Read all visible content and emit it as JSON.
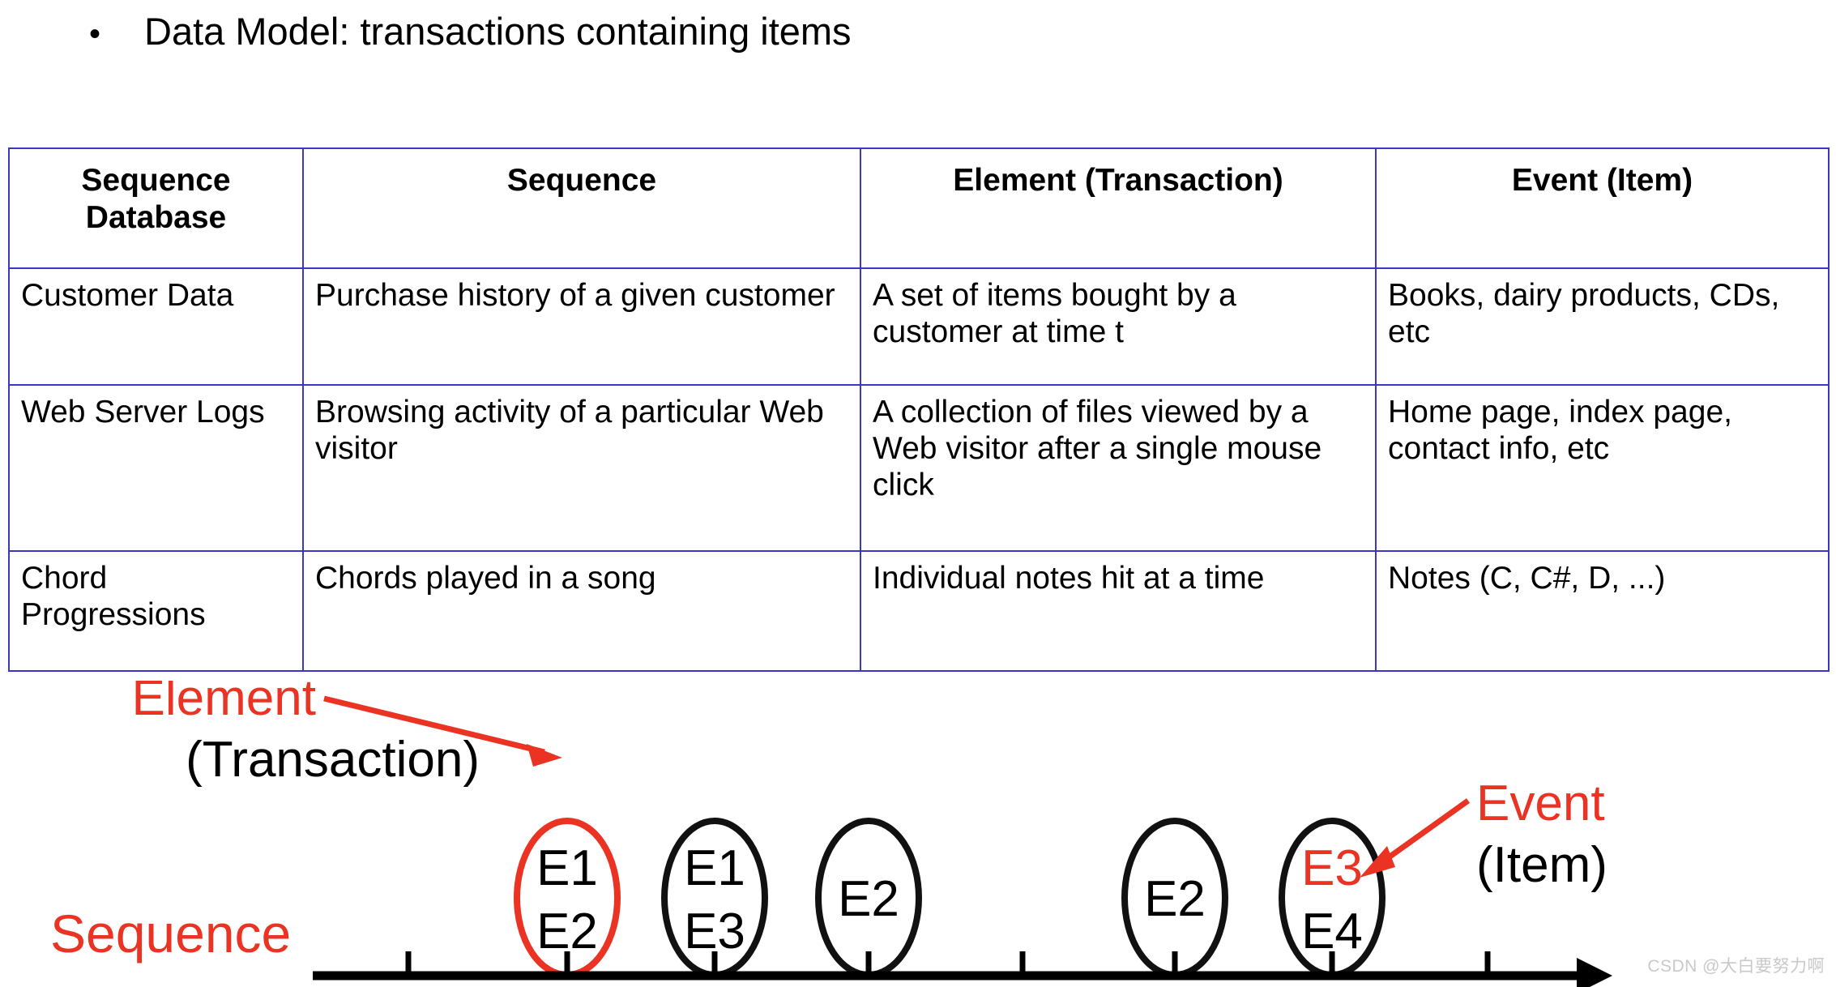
{
  "slide": {
    "bullet_glyph": "•",
    "title": "Data Model: transactions containing items"
  },
  "table": {
    "headers": [
      "Sequence Database",
      "Sequence",
      "Element (Transaction)",
      "Event (Item)"
    ],
    "rows": [
      {
        "database": "Customer Data",
        "sequence": "Purchase history of a given customer",
        "element": "A set of items bought by a customer at time t",
        "event": "Books, dairy products, CDs, etc"
      },
      {
        "database": "Web Server Logs",
        "sequence": "Browsing activity of a particular Web visitor",
        "element": "A collection of files viewed by a Web visitor after a single mouse click",
        "event": "Home page, index page, contact info, etc"
      },
      {
        "database": "Chord Progressions",
        "sequence": "Chords played in a song",
        "element": "Individual notes hit at a time",
        "event": "Notes (C, C#, D, ...)"
      }
    ],
    "border_color": "#3c36c4"
  },
  "diagram": {
    "labels": {
      "element_highlight": "Element",
      "element_sub": "(Transaction)",
      "event_highlight": "Event",
      "event_sub": "(Item)",
      "sequence": "Sequence"
    },
    "accent_color": "#ea3323",
    "line_color": "#000000",
    "ellipses": [
      {
        "id": "ellipse-1",
        "items": [
          "E1",
          "E2"
        ],
        "outline": "accent",
        "item_colors": [
          "black",
          "black"
        ]
      },
      {
        "id": "ellipse-2",
        "items": [
          "E1",
          "E3"
        ],
        "outline": "black",
        "item_colors": [
          "black",
          "black"
        ]
      },
      {
        "id": "ellipse-3",
        "items": [
          "E2"
        ],
        "outline": "black",
        "item_colors": [
          "black"
        ]
      },
      {
        "id": "ellipse-4",
        "items": [
          "E2"
        ],
        "outline": "black",
        "item_colors": [
          "black"
        ]
      },
      {
        "id": "ellipse-5",
        "items": [
          "E3",
          "E4"
        ],
        "outline": "black",
        "item_colors": [
          "accent",
          "black"
        ]
      }
    ],
    "axis": {
      "tick_count": 8
    }
  },
  "watermark": "CSDN @大白要努力啊"
}
